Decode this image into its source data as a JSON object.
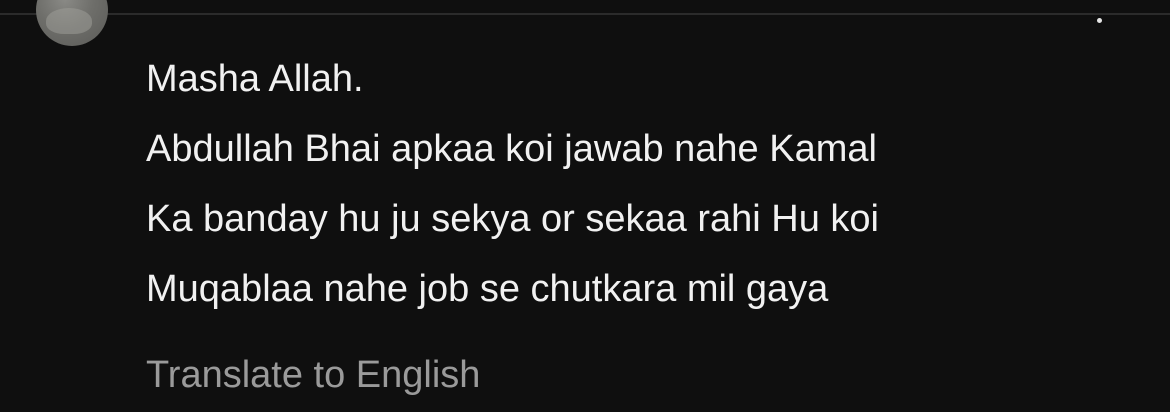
{
  "comment": {
    "lines": [
      "Masha Allah.",
      "Abdullah Bhai apkaa koi jawab nahe Kamal",
      "Ka banday hu ju sekya or sekaa rahi Hu koi",
      "Muqablaa nahe job se chutkara mil gaya"
    ],
    "translate_label": "Translate to English"
  },
  "icons": {
    "avatar": "user-avatar",
    "more": "more-vertical-icon"
  },
  "colors": {
    "background": "#0f0f0f",
    "text": "#f1f1f1",
    "secondary_text": "#9a9a9a"
  }
}
